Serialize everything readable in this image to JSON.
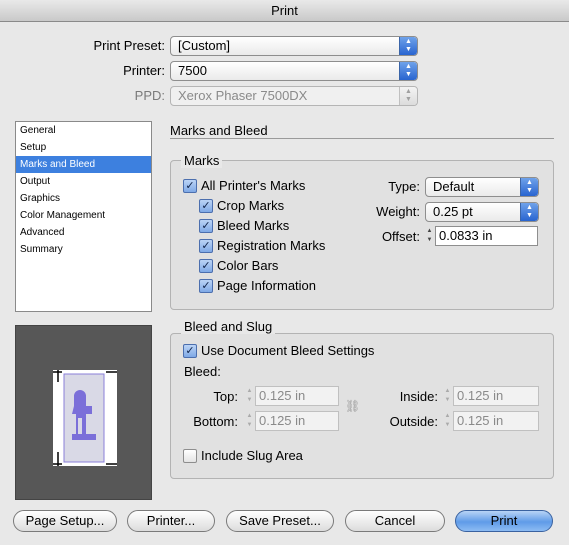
{
  "window": {
    "title": "Print"
  },
  "top": {
    "preset_label": "Print Preset:",
    "preset_value": "[Custom]",
    "printer_label": "Printer:",
    "printer_value": "7500",
    "ppd_label": "PPD:",
    "ppd_value": "Xerox Phaser 7500DX"
  },
  "sidebar": {
    "items": [
      {
        "label": "General"
      },
      {
        "label": "Setup"
      },
      {
        "label": "Marks and Bleed",
        "selected": true
      },
      {
        "label": "Output"
      },
      {
        "label": "Graphics"
      },
      {
        "label": "Color Management"
      },
      {
        "label": "Advanced"
      },
      {
        "label": "Summary"
      }
    ]
  },
  "main": {
    "title": "Marks and Bleed"
  },
  "marks": {
    "group_title": "Marks",
    "all_marks": {
      "label": "All Printer's Marks",
      "checked": true
    },
    "crop": {
      "label": "Crop Marks",
      "checked": true
    },
    "bleed": {
      "label": "Bleed Marks",
      "checked": true
    },
    "registration": {
      "label": "Registration Marks",
      "checked": true
    },
    "color_bars": {
      "label": "Color Bars",
      "checked": true
    },
    "page_info": {
      "label": "Page Information",
      "checked": true
    },
    "type_label": "Type:",
    "type_value": "Default",
    "weight_label": "Weight:",
    "weight_value": "0.25 pt",
    "offset_label": "Offset:",
    "offset_value": "0.0833 in"
  },
  "bleed_slug": {
    "group_title": "Bleed and Slug",
    "use_doc": {
      "label": "Use Document Bleed Settings",
      "checked": true
    },
    "bleed_label": "Bleed:",
    "top_label": "Top:",
    "top_value": "0.125 in",
    "bottom_label": "Bottom:",
    "bottom_value": "0.125 in",
    "inside_label": "Inside:",
    "inside_value": "0.125 in",
    "outside_label": "Outside:",
    "outside_value": "0.125 in",
    "slug": {
      "label": "Include Slug Area",
      "checked": false
    }
  },
  "buttons": {
    "page_setup": "Page Setup...",
    "printer": "Printer...",
    "save_preset": "Save Preset...",
    "cancel": "Cancel",
    "print": "Print"
  },
  "colors": {
    "selection": "#3d80df",
    "popup_accent": "#2864d0",
    "preview_bg": "#575757"
  },
  "icons": {
    "popup_arrows": "up-down-arrows",
    "checkbox": "checkmark",
    "stepper": "up-down-stepper",
    "chain": "link-icon"
  }
}
